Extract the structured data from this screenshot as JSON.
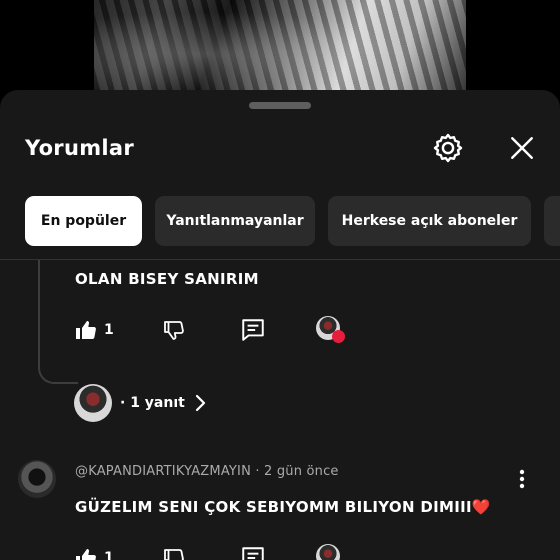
{
  "sheet": {
    "title": "Yorumlar",
    "settings_icon": "gear-icon",
    "close_icon": "close-icon"
  },
  "filters": [
    {
      "label": "En popüler",
      "active": true
    },
    {
      "label": "Yanıtlanmayanlar",
      "active": false
    },
    {
      "label": "Herkese açık aboneler",
      "active": false
    }
  ],
  "comment1": {
    "text": "OLAN BISEY SANIRIM",
    "like_count": "1",
    "replies_label": "· 1 yanıt"
  },
  "comment2": {
    "author": "@KAPANDIARTIKYAZMAYIN",
    "time": "· 2 gün önce",
    "text": "GÜZELIM SENI ÇOK SEBIYOMM BILIYON DIMIII❤️",
    "like_count": "1"
  },
  "colors": {
    "sheet_bg": "#181818",
    "chip_bg": "#2b2b2b",
    "chip_active_bg": "#ffffff",
    "heart": "#e61e3c"
  }
}
